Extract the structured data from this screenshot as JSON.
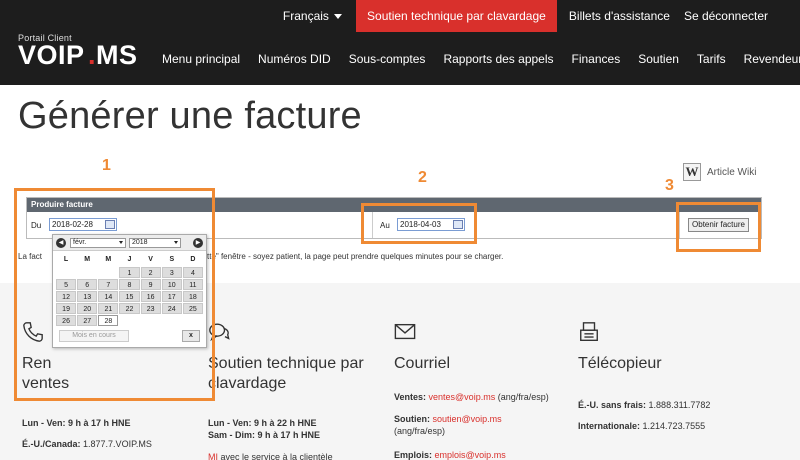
{
  "header": {
    "language": "Français",
    "chat_support": "Soutien technique par clavardage",
    "tickets": "Billets d'assistance",
    "logout": "Se déconnecter",
    "logo_sub": "Portail Client",
    "logo_brand": "VOIP.MS",
    "brand_color": "#d9302c"
  },
  "nav": [
    "Menu principal",
    "Numéros DID",
    "Sous-comptes",
    "Rapports des appels",
    "Finances",
    "Soutien",
    "Tarifs",
    "Revendeur"
  ],
  "page_title": "Générer une facture",
  "wiki_label": "Article Wiki",
  "wiki_icon": "W",
  "panel": {
    "header": "Produire facture",
    "from_label": "Du",
    "from_value": "2018-02-28",
    "to_label": "Au",
    "to_value": "2018-04-03",
    "button": "Obtenir facture"
  },
  "notice_left": "La fact",
  "notice_right": "tte\" fenêtre - soyez patient, la page peut prendre quelques minutes pour se charger.",
  "annotations": [
    "1",
    "2",
    "3"
  ],
  "picker": {
    "month": "févr.",
    "year": "2018",
    "weekdays": [
      "L",
      "M",
      "M",
      "J",
      "V",
      "S",
      "D"
    ],
    "days": [
      "",
      "",
      "",
      "1",
      "2",
      "3",
      "4",
      "5",
      "6",
      "7",
      "8",
      "9",
      "10",
      "11",
      "12",
      "13",
      "14",
      "15",
      "16",
      "17",
      "18",
      "19",
      "20",
      "21",
      "22",
      "23",
      "24",
      "25",
      "26",
      "27",
      "28"
    ],
    "selected_day": "28",
    "today_button": "Mois en cours",
    "close_button": "x"
  },
  "footer": {
    "phone_head_1": "Ren",
    "phone_head_2": "ventes",
    "phone_hours": "Lun - Ven: 9 h à 17 h HNE",
    "phone_number_label": "É.-U./Canada:",
    "phone_number": "1.877.7.VOIP.MS",
    "chat_head": "Soutien technique par clavardage",
    "chat_hours_1": "Lun - Ven: 9 h à 22 h HNE",
    "chat_hours_2": "Sam - Dim: 9 h à 17 h HNE",
    "chat_note_link": "MI",
    "chat_note": "avec le service à la clientèle",
    "mail_head": "Courriel",
    "sales_label": "Ventes:",
    "sales_email": "ventes@voip.ms",
    "sales_lang": "(ang/fra/esp)",
    "support_label": "Soutien:",
    "support_email": "soutien@voip.ms",
    "support_lang": "(ang/fra/esp)",
    "jobs_label": "Emplois:",
    "jobs_email": "emplois@voip.ms",
    "fax_head": "Télécopieur",
    "fax_us_label": "É.-U. sans frais:",
    "fax_us": "1.888.311.7782",
    "fax_intl_label": "Internationale:",
    "fax_intl": "1.214.723.7555"
  }
}
